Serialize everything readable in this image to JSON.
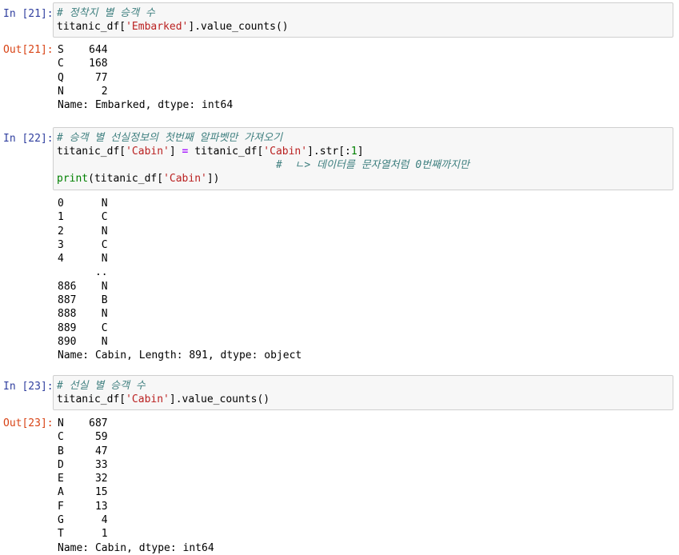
{
  "cells": [
    {
      "in_prompt": "In [21]:",
      "code": {
        "line1_comment": "# 정착지 별 승객 수",
        "line2": {
          "a": "titanic_df[",
          "s": "'Embarked'",
          "b": "].value_counts()"
        }
      },
      "out_prompt": "Out[21]:",
      "output": [
        "S    644",
        "C    168",
        "Q     77",
        "N      2",
        "Name: Embarked, dtype: int64"
      ]
    },
    {
      "in_prompt": "In [22]:",
      "code": {
        "line1_comment": "# 승객 별 선실정보의 첫번째 알파벳만 가져오기",
        "line2": {
          "a": "titanic_df[",
          "s1": "'Cabin'",
          "b": "] ",
          "eq": "=",
          "c": " titanic_df[",
          "s2": "'Cabin'",
          "d": "].str[:",
          "n": "1",
          "e": "]"
        },
        "line3_indent": "                                   ",
        "line3_comment": "#  ㄴ> 데이터를 문자열처럼 0번째까지만",
        "line4": {
          "fn": "print",
          "a": "(titanic_df[",
          "s": "'Cabin'",
          "b": "])"
        }
      },
      "output": [
        "0      N",
        "1      C",
        "2      N",
        "3      C",
        "4      N",
        "      ..",
        "886    N",
        "887    B",
        "888    N",
        "889    C",
        "890    N",
        "Name: Cabin, Length: 891, dtype: object"
      ]
    },
    {
      "in_prompt": "In [23]:",
      "code": {
        "line1_comment": "# 선실 별 승객 수",
        "line2": {
          "a": "titanic_df[",
          "s": "'Cabin'",
          "b": "].value_counts()"
        }
      },
      "out_prompt": "Out[23]:",
      "output": [
        "N    687",
        "C     59",
        "B     47",
        "D     33",
        "E     32",
        "A     15",
        "F     13",
        "G      4",
        "T      1",
        "Name: Cabin, dtype: int64"
      ]
    }
  ]
}
